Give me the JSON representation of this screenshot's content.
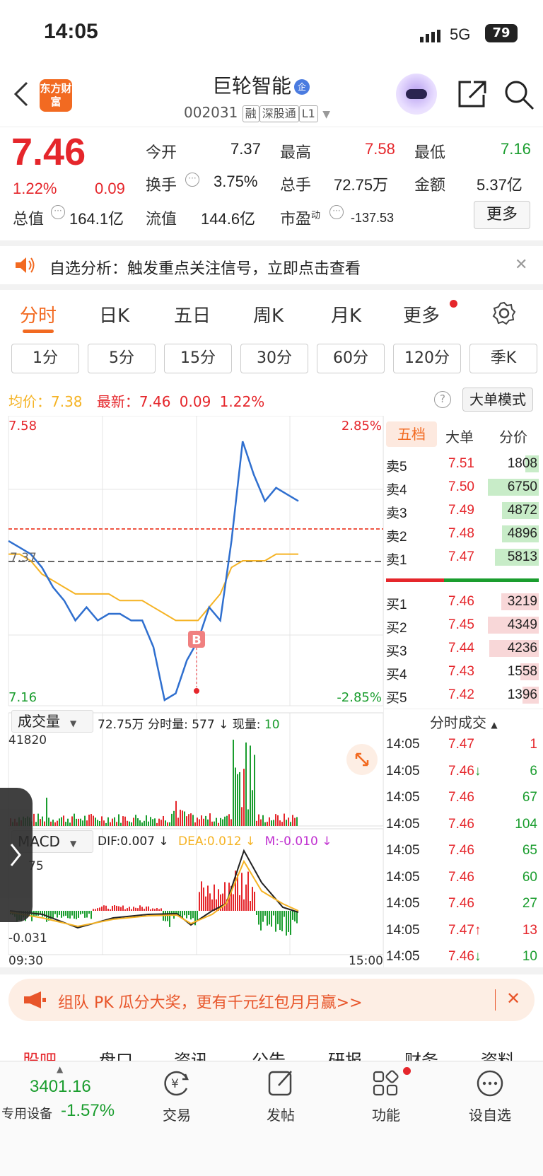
{
  "status": {
    "time": "14:05",
    "network": "5G",
    "battery": "79"
  },
  "header": {
    "logo": "东方财富",
    "name": "巨轮智能",
    "name_badge": "企",
    "code": "002031",
    "tags": [
      "融",
      "深股通",
      "L1"
    ]
  },
  "quote": {
    "price": "7.46",
    "pct": "1.22%",
    "chg": "0.09",
    "labels": {
      "open": "今开",
      "high": "最高",
      "low": "最低",
      "turnover": "换手",
      "volume": "总手",
      "amount": "金额",
      "mktcap": "总值",
      "float": "流值",
      "pe": "市盈",
      "pe_sup": "动"
    },
    "values": {
      "open": "7.37",
      "high": "7.58",
      "low": "7.16",
      "turnover": "3.75%",
      "volume": "72.75万",
      "amount": "5.37亿",
      "mktcap": "164.1亿",
      "float": "144.6亿",
      "pe": "-137.53"
    },
    "more": "更多"
  },
  "notice": {
    "text": "自选分析：触发重点关注信号，立即点击查看"
  },
  "tabs": [
    "分时",
    "日K",
    "五日",
    "周K",
    "月K",
    "更多"
  ],
  "period_tabs": [
    "1分",
    "5分",
    "15分",
    "30分",
    "60分",
    "120分",
    "季K"
  ],
  "info_line": {
    "avg_label": "均价：",
    "avg": "7.38",
    "latest_label": "最新：",
    "latest": "7.46",
    "chg": "0.09",
    "pct": "1.22%",
    "mode": "大单模式"
  },
  "chart": {
    "ytop": "7.58",
    "ybot": "7.16",
    "pct_top": "2.85%",
    "pct_bot": "-2.85%",
    "ref": "7.37",
    "marker": "B",
    "vol_label": "成交量",
    "vol_info": "72.75万",
    "vol_min_label": "分时量:",
    "vol_min": "577",
    "vol_now_label": "现量:",
    "vol_now": "10",
    "vol_max": "41820",
    "macd_label": "MACD",
    "dif": "DIF:0.007",
    "dea": "DEA:0.012",
    "m": "M:-0.010",
    "macd_top": "75",
    "macd_bot": "-0.031",
    "t_start": "09:30",
    "t_end": "15:00"
  },
  "chart_data": {
    "type": "line",
    "series": [
      {
        "name": "",
        "values": [
          7.4,
          7.39,
          7.38,
          7.36,
          7.33,
          7.31,
          7.28,
          7.3,
          7.28,
          7.29,
          7.29,
          7.28,
          7.28,
          7.24,
          7.16,
          7.17,
          7.22,
          7.25,
          7.3,
          7.28,
          7.4,
          7.55,
          7.5,
          7.46,
          7.48,
          7.47,
          7.46
        ]
      },
      {
        "name": "",
        "values": [
          7.38,
          7.38,
          7.37,
          7.35,
          7.34,
          7.33,
          7.32,
          7.32,
          7.32,
          7.32,
          7.31,
          7.31,
          7.31,
          7.3,
          7.29,
          7.28,
          7.28,
          7.28,
          7.3,
          7.32,
          7.36,
          7.37,
          7.37,
          7.37,
          7.38,
          7.38,
          7.38
        ]
      }
    ],
    "ylim": [
      7.16,
      7.58
    ]
  },
  "book": {
    "tabs": [
      "五档",
      "大单",
      "分价"
    ],
    "asks": [
      {
        "l": "卖5",
        "p": "7.51",
        "v": "1808"
      },
      {
        "l": "卖4",
        "p": "7.50",
        "v": "6750"
      },
      {
        "l": "卖3",
        "p": "7.49",
        "v": "4872"
      },
      {
        "l": "卖2",
        "p": "7.48",
        "v": "4896"
      },
      {
        "l": "卖1",
        "p": "7.47",
        "v": "5813"
      }
    ],
    "bids": [
      {
        "l": "买1",
        "p": "7.46",
        "v": "3219"
      },
      {
        "l": "买2",
        "p": "7.45",
        "v": "4349"
      },
      {
        "l": "买3",
        "p": "7.44",
        "v": "4236"
      },
      {
        "l": "买4",
        "p": "7.43",
        "v": "1558"
      },
      {
        "l": "买5",
        "p": "7.42",
        "v": "1396"
      }
    ],
    "ticks_title": "分时成交",
    "ticks": [
      {
        "t": "14:05",
        "p": "7.47",
        "a": "",
        "v": "1",
        "c": "red"
      },
      {
        "t": "14:05",
        "p": "7.46",
        "a": "↓",
        "v": "6",
        "c": "green"
      },
      {
        "t": "14:05",
        "p": "7.46",
        "a": "",
        "v": "67",
        "c": "green"
      },
      {
        "t": "14:05",
        "p": "7.46",
        "a": "",
        "v": "104",
        "c": "green"
      },
      {
        "t": "14:05",
        "p": "7.46",
        "a": "",
        "v": "65",
        "c": "green"
      },
      {
        "t": "14:05",
        "p": "7.46",
        "a": "",
        "v": "60",
        "c": "green"
      },
      {
        "t": "14:05",
        "p": "7.46",
        "a": "",
        "v": "27",
        "c": "green"
      },
      {
        "t": "14:05",
        "p": "7.47",
        "a": "↑",
        "v": "13",
        "c": "red"
      },
      {
        "t": "14:05",
        "p": "7.46",
        "a": "↓",
        "v": "10",
        "c": "green"
      }
    ]
  },
  "promo": {
    "text": "组队 PK 瓜分大奖，更有千元红包月月赢>>"
  },
  "subtabs": [
    "股吧",
    "盘口",
    "资讯",
    "公告",
    "研报",
    "财务",
    "资料"
  ],
  "bottom": {
    "index": "3401.16",
    "index_label": "专用设备",
    "index_pct": "-1.57%",
    "items": [
      "交易",
      "发帖",
      "功能",
      "设自选"
    ]
  },
  "colors": {
    "up": "#e5262b",
    "down": "#1a9d2e",
    "accent": "#f26a21",
    "price_line": "#2f6fcf",
    "avg_line": "#f5b324"
  }
}
